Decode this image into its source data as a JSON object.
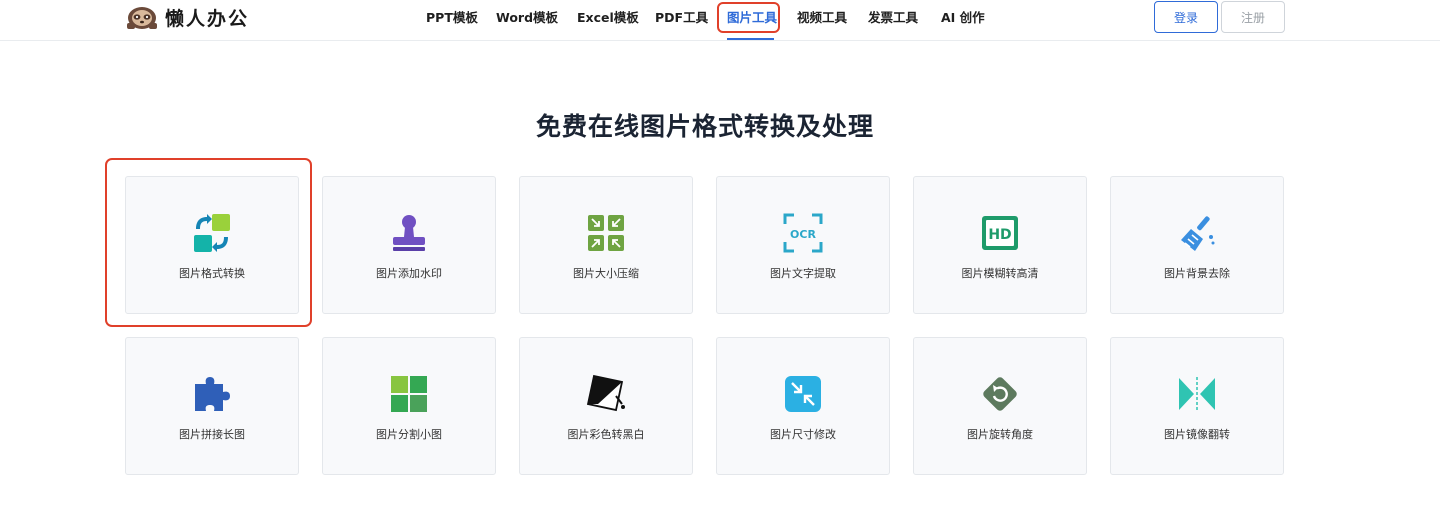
{
  "header": {
    "brand": "懒人办公",
    "nav": [
      {
        "label": "PPT模板",
        "active": false
      },
      {
        "label": "Word模板",
        "active": false
      },
      {
        "label": "Excel模板",
        "active": false
      },
      {
        "label": "PDF工具",
        "active": false
      },
      {
        "label": "图片工具",
        "active": true
      },
      {
        "label": "视频工具",
        "active": false
      },
      {
        "label": "发票工具",
        "active": false
      },
      {
        "label": "AI 创作",
        "active": false
      }
    ],
    "login_label": "登录",
    "register_label": "注册"
  },
  "main": {
    "title": "免费在线图片格式转换及处理",
    "tools": [
      {
        "label": "图片格式转换",
        "icon": "format-convert-icon"
      },
      {
        "label": "图片添加水印",
        "icon": "stamp-icon"
      },
      {
        "label": "图片大小压缩",
        "icon": "compress-icon"
      },
      {
        "label": "图片文字提取",
        "icon": "ocr-icon"
      },
      {
        "label": "图片模糊转高清",
        "icon": "hd-icon"
      },
      {
        "label": "图片背景去除",
        "icon": "brush-icon"
      },
      {
        "label": "图片拼接长图",
        "icon": "puzzle-icon"
      },
      {
        "label": "图片分割小图",
        "icon": "grid-split-icon"
      },
      {
        "label": "图片彩色转黑白",
        "icon": "color-to-bw-icon"
      },
      {
        "label": "图片尺寸修改",
        "icon": "resize-icon"
      },
      {
        "label": "图片旋转角度",
        "icon": "rotate-icon"
      },
      {
        "label": "图片镜像翻转",
        "icon": "mirror-flip-icon"
      }
    ]
  },
  "colors": {
    "accent": "#2f6bd8",
    "highlight": "#e0402a",
    "card_bg": "#f8f9fb"
  }
}
